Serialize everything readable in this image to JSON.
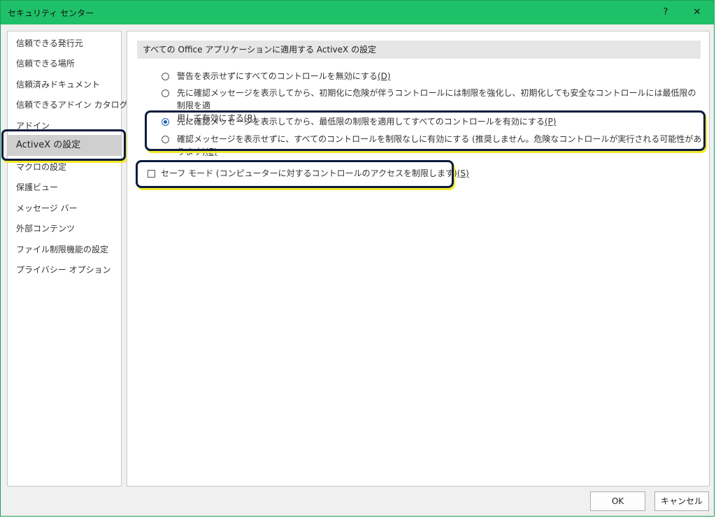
{
  "window": {
    "title": "セキュリティ センター",
    "help_label": "?",
    "close_label": "✕"
  },
  "sidebar": {
    "items": [
      {
        "label": "信頼できる発行元"
      },
      {
        "label": "信頼できる場所"
      },
      {
        "label": "信頼済みドキュメント"
      },
      {
        "label": "信頼できるアドイン カタログ"
      },
      {
        "label": "アドイン"
      },
      {
        "label": "ActiveX の設定",
        "selected": true
      },
      {
        "label": "マクロの設定"
      },
      {
        "label": "保護ビュー"
      },
      {
        "label": "メッセージ バー"
      },
      {
        "label": "外部コンテンツ"
      },
      {
        "label": "ファイル制限機能の設定"
      },
      {
        "label": "プライバシー オプション"
      }
    ]
  },
  "main": {
    "section_title": "すべての Office アプリケーションに適用する ActiveX の設定",
    "options": [
      {
        "text": "警告を表示せずにすべてのコントロールを無効にする",
        "key": "(D)",
        "checked": false
      },
      {
        "text": "先に確認メッセージを表示してから、初期化に危険が伴うコントロールには制限を強化し、初期化しても安全なコントロールには最低限の制限を適",
        "text_line2": "用して有効にする",
        "key": "(R)",
        "checked": false
      },
      {
        "text": "先に確認メッセージを表示してから、最低限の制限を適用してすべてのコントロールを有効にする",
        "key": "(P)",
        "checked": true
      },
      {
        "text": "確認メッセージを表示せずに、すべてのコントロールを制限なしに有効にする (推奨しません。危険なコントロールが実行される可能性があります)",
        "key": "(E)",
        "checked": false
      }
    ],
    "safe_mode": {
      "text": "セーフ モード (コンピューターに対するコントロールのアクセスを制限します)",
      "key": "(S)",
      "checked": false
    }
  },
  "footer": {
    "ok_label": "OK",
    "cancel_label": "キャンセル"
  },
  "colors": {
    "titlebar": "#1fc168",
    "highlight_border": "#0d1b3e",
    "highlight_shadow": "#f2ea2a",
    "radio_selected": "#1a5fb4"
  }
}
